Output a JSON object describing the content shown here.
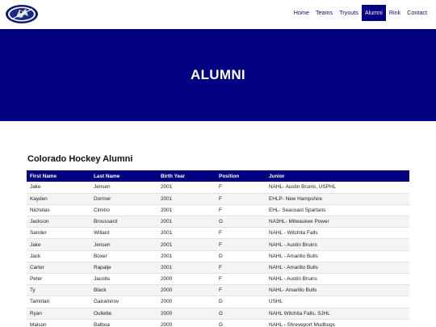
{
  "nav": {
    "items": [
      {
        "label": "Home",
        "active": false
      },
      {
        "label": "Teams",
        "active": false
      },
      {
        "label": "Tryouts",
        "active": false
      },
      {
        "label": "Alumni",
        "active": true
      },
      {
        "label": "Rink",
        "active": false
      },
      {
        "label": "Contact",
        "active": false
      }
    ]
  },
  "logo": {
    "icon": "team-logo-icon"
  },
  "hero": {
    "title": "ALUMNI"
  },
  "section": {
    "title": "Colorado Hockey Alumni"
  },
  "table": {
    "headers": [
      "First Name",
      "Last Name",
      "Birth Year",
      "Position",
      "Junior"
    ],
    "rows": [
      [
        "Jake",
        "Jensen",
        "2001",
        "F",
        "NAHL- Austin Bruins, USPHL"
      ],
      [
        "Kayden",
        "Dormer",
        "2001",
        "F",
        "EHLP- New Hampshire"
      ],
      [
        "Nicholas",
        "Cimino",
        "2001",
        "F",
        "EHL- Seacoast Spartans"
      ],
      [
        "Jackson",
        "Broussard",
        "2001",
        "G",
        "NA3HL- Milwaukee Power"
      ],
      [
        "Sander",
        "Willard",
        "2001",
        "F",
        "NAHL - Witchita Falls"
      ],
      [
        "Jake",
        "Jensen",
        "2001",
        "F",
        "NAHL - Austin Bruins"
      ],
      [
        "Jack",
        "Boxer",
        "2001",
        "D",
        "NAHL - Amarillo Bulls"
      ],
      [
        "Carter",
        "Rapalje",
        "2001",
        "F",
        "NAHL - Amarillo Bulls"
      ],
      [
        "Peter",
        "Jacobs",
        "2000",
        "F",
        "NAHL - Austin Bruins"
      ],
      [
        "Ty",
        "Black",
        "2000",
        "F",
        "NAHL- Amarillo Bulls"
      ],
      [
        "Tamirlan",
        "Gairamirov",
        "2000",
        "D",
        "USHL"
      ],
      [
        "Ryan",
        "Oullette",
        "2000",
        "G",
        "NAHL Witchita Falls, SJHL"
      ],
      [
        "Maison",
        "Balboa",
        "2000",
        "G",
        "NAHL - Shreveport Mudbugs"
      ]
    ]
  },
  "colors": {
    "brand_navy": "#000080"
  }
}
